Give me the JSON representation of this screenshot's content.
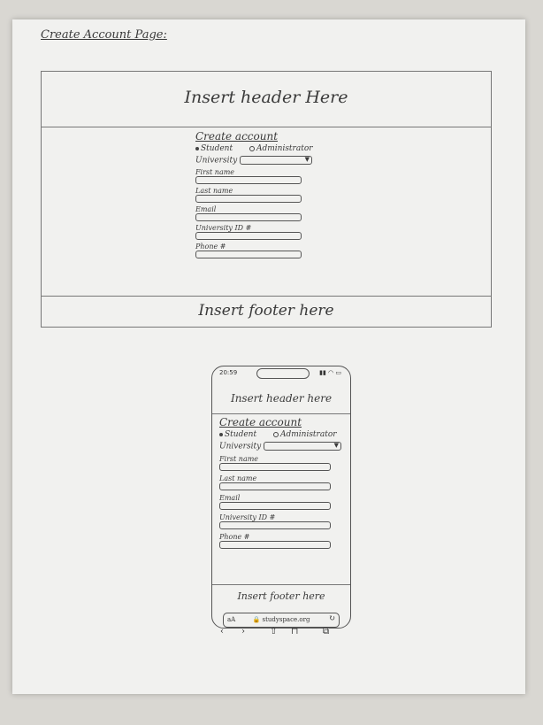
{
  "page_title": "Create Account Page:",
  "desktop": {
    "header": "Insert header Here",
    "footer": "Insert footer here",
    "form": {
      "title": "Create account",
      "radio_student": "Student",
      "radio_admin": "Administrator",
      "university_label": "University",
      "first_name": "First name",
      "last_name": "Last name",
      "email": "Email",
      "university_id": "University ID #",
      "phone": "Phone #"
    }
  },
  "mobile": {
    "status_time": "20:59",
    "status_icons": "▮▮ ◠ ▭",
    "header": "Insert header here",
    "footer": "Insert footer here",
    "form": {
      "title": "Create account",
      "radio_student": "Student",
      "radio_admin": "Administrator",
      "university_label": "University",
      "first_name": "First name",
      "last_name": "Last name",
      "email": "Email",
      "university_id": "University ID #",
      "phone": "Phone #"
    },
    "browser": {
      "aa": "aA",
      "url": "🔒 studyspace.org",
      "reload": "↻"
    },
    "nav": {
      "back": "‹",
      "forward": "›",
      "share": "⇧",
      "bookmarks": "⊓",
      "tabs": "⧉"
    }
  }
}
